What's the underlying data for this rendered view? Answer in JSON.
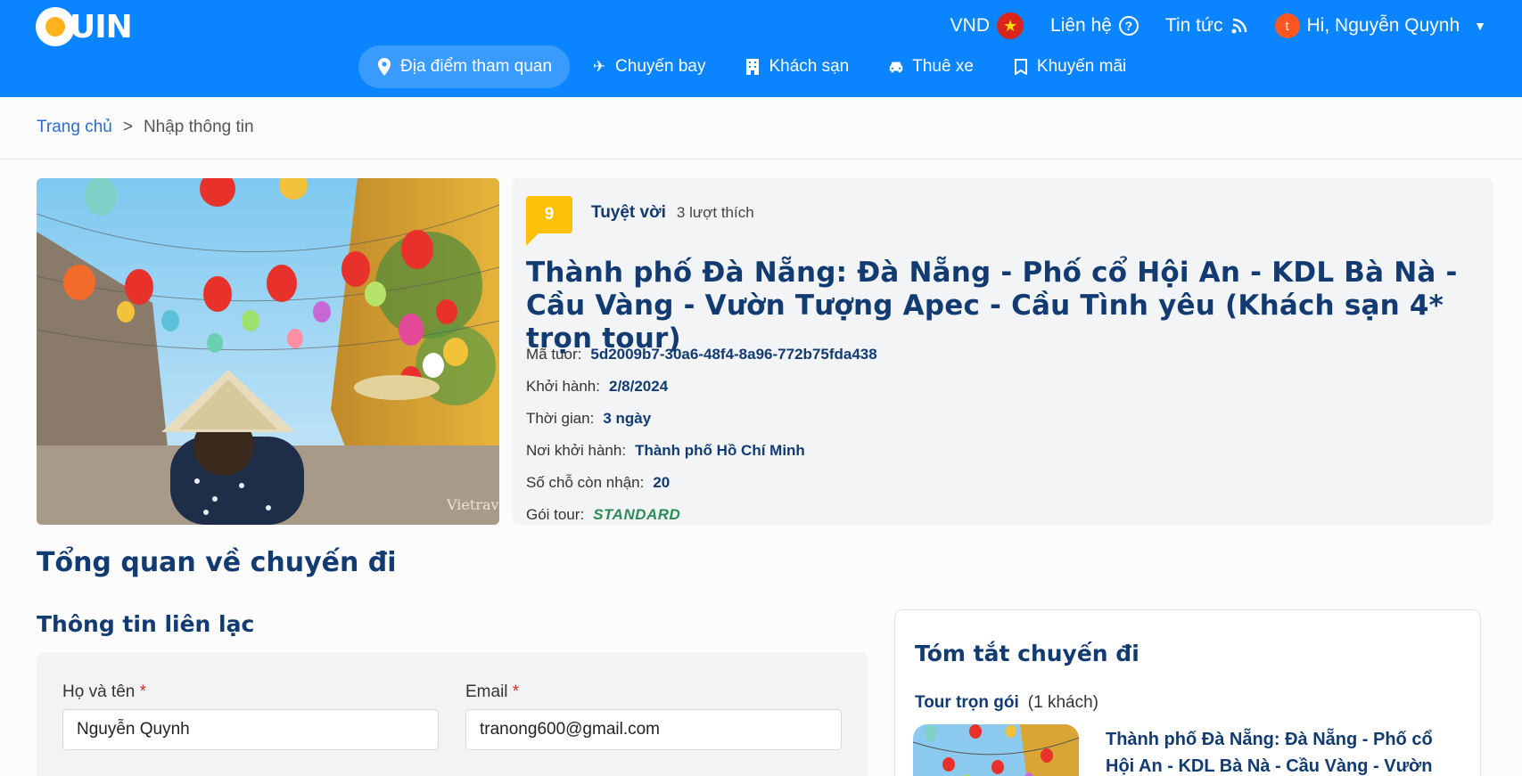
{
  "brand": {
    "logo_text": "UIN",
    "primary": "#0a84ff",
    "accent": "#ffb21c"
  },
  "header": {
    "currency": "VND",
    "contact": "Liên hệ",
    "news": "Tin tức",
    "avatar_initial": "t",
    "greeting": "Hi, Nguyễn Quynh"
  },
  "nav": {
    "items": [
      {
        "label": "Địa điểm tham quan",
        "icon": "map-pin-icon",
        "active": true
      },
      {
        "label": "Chuyến bay",
        "icon": "plane-icon"
      },
      {
        "label": "Khách sạn",
        "icon": "building-icon"
      },
      {
        "label": "Thuê xe",
        "icon": "car-icon"
      },
      {
        "label": "Khuyến mãi",
        "icon": "bookmark-icon"
      }
    ]
  },
  "breadcrumb": {
    "home": "Trang chủ",
    "separator": ">",
    "current": "Nhập thông tin"
  },
  "tour": {
    "score": "9",
    "rating_label": "Tuyệt vời",
    "likes": "3 lượt thích",
    "title": "Thành phố Đà Nẵng: Đà Nẵng - Phố cổ Hội An - KDL Bà Nà - Cầu Vàng - Vườn Tượng Apec - Cầu Tình yêu (Khách sạn 4* trọn tour)",
    "meta": {
      "code_label": "Mã tuor:",
      "code": "5d2009b7-30a6-48f4-8a96-772b75fda438",
      "start_label": "Khởi hành:",
      "start": "2/8/2024",
      "duration_label": "Thời gian:",
      "duration": "3 ngày",
      "origin_label": "Nơi khởi hành:",
      "origin": "Thành phố Hồ Chí Minh",
      "seats_label": "Số chỗ còn nhận:",
      "seats": "20",
      "package_label": "Gói tour:",
      "package": "STANDARD"
    },
    "image_watermark": "Vietrav"
  },
  "overview": {
    "title": "Tổng quan về chuyến đi"
  },
  "contact": {
    "title": "Thông tin liên lạc",
    "name_label": "Họ và tên",
    "name_value": "Nguyễn Quynh",
    "email_label": "Email",
    "email_value": "tranong600@gmail.com",
    "required_mark": "*"
  },
  "summary": {
    "title": "Tóm tắt chuyến đi",
    "package_label": "Tour trọn gói",
    "guests": "(1 khách)",
    "tour_title": "Thành phố Đà Nẵng: Đà Nẵng - Phố cổ Hội An - KDL Bà Nà - Cầu Vàng - Vườn"
  }
}
